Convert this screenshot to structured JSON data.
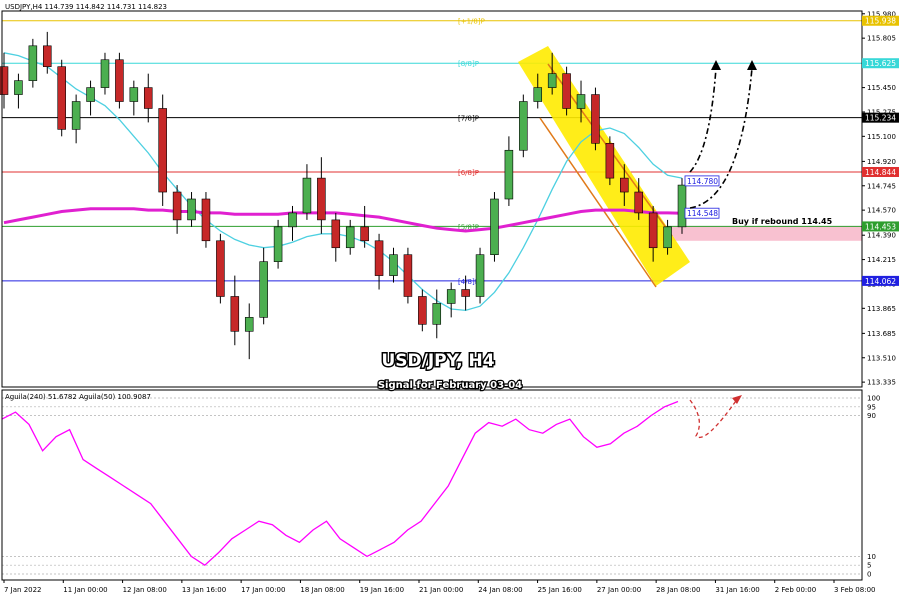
{
  "header": {
    "symbol_line": "USDJPY,H4  114.739 114.842 114.731 114.823",
    "indicator_line": "Aguila(240) 51.6782  Aguila(50) 100.9087"
  },
  "title": {
    "main": "USD/JPY, H4",
    "subtitle": "Signal for February 03-04"
  },
  "annotation": {
    "text": "Buy if rebound 114.45"
  },
  "colors": {
    "bull": "#4caf50",
    "bear": "#c62828",
    "sma_fast": "#4dd0e1",
    "sma_slow": "#e020d0",
    "channel_fill": "#ffeb00",
    "channel_border": "#e07a1a",
    "buy_zone": "#f7b6c8",
    "oscillator": "#ff00ff"
  },
  "chart_data": [
    {
      "type": "candlestick",
      "title": "USDJPY,H4",
      "ylim": [
        113.3,
        116.0
      ],
      "price_ticks": [
        "115.980",
        "115.805",
        "115.450",
        "115.275",
        "115.100",
        "114.920",
        "114.745",
        "114.570",
        "114.390",
        "114.215",
        "114.040",
        "113.865",
        "113.685",
        "113.510",
        "113.335"
      ],
      "date_ticks": [
        "7 Jan 2022",
        "11 Jan 00:00",
        "12 Jan 08:00",
        "13 Jan 16:00",
        "17 Jan 00:00",
        "18 Jan 08:00",
        "19 Jan 16:00",
        "21 Jan 00:00",
        "24 Jan 08:00",
        "25 Jan 16:00",
        "27 Jan 00:00",
        "28 Jan 08:00",
        "31 Jan 16:00",
        "2 Feb 00:00",
        "3 Feb 08:00"
      ],
      "murrey_levels": [
        {
          "label": "[+1/8]P",
          "price": 115.93,
          "color": "#e8c200",
          "value_label": "115.938"
        },
        {
          "label": "[8/8]P",
          "price": 115.625,
          "color": "#38d8d8",
          "value_label": "115.625"
        },
        {
          "label": "[7/8]P",
          "price": 115.234,
          "color": "#000000",
          "value_label": "115.234"
        },
        {
          "label": "[6/8]P",
          "price": 114.844,
          "color": "#e03030",
          "value_label": "114.844"
        },
        {
          "label": "[5/8]P",
          "price": 114.453,
          "color": "#2e9e2e",
          "value_label": "114.453"
        },
        {
          "label": "[4/8]P",
          "price": 114.062,
          "color": "#2020e0",
          "value_label": "114.062"
        }
      ],
      "marker_labels": [
        {
          "text": "114.780",
          "price": 114.78,
          "color": "#2020e0"
        },
        {
          "text": "114.548",
          "price": 114.548,
          "color": "#2020e0"
        }
      ],
      "candles": [
        [
          115.6,
          115.7,
          115.3,
          115.4
        ],
        [
          115.4,
          115.55,
          115.3,
          115.5
        ],
        [
          115.5,
          115.8,
          115.45,
          115.75
        ],
        [
          115.75,
          115.85,
          115.55,
          115.6
        ],
        [
          115.6,
          115.65,
          115.1,
          115.15
        ],
        [
          115.15,
          115.4,
          115.05,
          115.35
        ],
        [
          115.35,
          115.5,
          115.25,
          115.45
        ],
        [
          115.45,
          115.7,
          115.4,
          115.65
        ],
        [
          115.65,
          115.7,
          115.3,
          115.35
        ],
        [
          115.35,
          115.5,
          115.25,
          115.45
        ],
        [
          115.45,
          115.55,
          115.2,
          115.3
        ],
        [
          115.3,
          115.4,
          114.6,
          114.7
        ],
        [
          114.7,
          114.75,
          114.4,
          114.5
        ],
        [
          114.5,
          114.7,
          114.45,
          114.65
        ],
        [
          114.65,
          114.7,
          114.3,
          114.35
        ],
        [
          114.35,
          114.4,
          113.9,
          113.95
        ],
        [
          113.95,
          114.1,
          113.6,
          113.7
        ],
        [
          113.7,
          113.9,
          113.5,
          113.8
        ],
        [
          113.8,
          114.3,
          113.75,
          114.2
        ],
        [
          114.2,
          114.5,
          114.15,
          114.45
        ],
        [
          114.45,
          114.6,
          114.35,
          114.55
        ],
        [
          114.55,
          114.9,
          114.5,
          114.8
        ],
        [
          114.8,
          114.95,
          114.4,
          114.5
        ],
        [
          114.5,
          114.55,
          114.2,
          114.3
        ],
        [
          114.3,
          114.5,
          114.25,
          114.45
        ],
        [
          114.45,
          114.6,
          114.3,
          114.35
        ],
        [
          114.35,
          114.4,
          114.0,
          114.1
        ],
        [
          114.1,
          114.3,
          114.05,
          114.25
        ],
        [
          114.25,
          114.3,
          113.9,
          113.95
        ],
        [
          113.95,
          114.0,
          113.7,
          113.75
        ],
        [
          113.75,
          114.0,
          113.65,
          113.9
        ],
        [
          113.9,
          114.05,
          113.8,
          114.0
        ],
        [
          114.0,
          114.1,
          113.85,
          113.95
        ],
        [
          113.95,
          114.3,
          113.9,
          114.25
        ],
        [
          114.25,
          114.7,
          114.2,
          114.65
        ],
        [
          114.65,
          115.1,
          114.6,
          115.0
        ],
        [
          115.0,
          115.4,
          114.95,
          115.35
        ],
        [
          115.35,
          115.55,
          115.3,
          115.45
        ],
        [
          115.45,
          115.7,
          115.4,
          115.55
        ],
        [
          115.55,
          115.6,
          115.25,
          115.3
        ],
        [
          115.3,
          115.5,
          115.2,
          115.4
        ],
        [
          115.4,
          115.45,
          115.0,
          115.05
        ],
        [
          115.05,
          115.1,
          114.75,
          114.8
        ],
        [
          114.8,
          114.9,
          114.6,
          114.7
        ],
        [
          114.7,
          114.8,
          114.5,
          114.55
        ],
        [
          114.55,
          114.6,
          114.2,
          114.3
        ],
        [
          114.3,
          114.5,
          114.25,
          114.45
        ],
        [
          114.45,
          114.8,
          114.4,
          114.75
        ]
      ],
      "series": [
        {
          "name": "fast MA",
          "values": [
            115.7,
            115.68,
            115.64,
            115.6,
            115.52,
            115.44,
            115.38,
            115.32,
            115.22,
            115.1,
            114.98,
            114.84,
            114.72,
            114.6,
            114.5,
            114.42,
            114.36,
            114.32,
            114.3,
            114.31,
            114.34,
            114.38,
            114.4,
            114.4,
            114.38,
            114.34,
            114.28,
            114.2,
            114.1,
            114.0,
            113.92,
            113.86,
            113.85,
            113.88,
            113.98,
            114.12,
            114.3,
            114.5,
            114.72,
            114.92,
            115.06,
            115.14,
            115.16,
            115.12,
            115.02,
            114.9,
            114.82,
            114.8
          ]
        },
        {
          "name": "slow MA",
          "values": [
            114.48,
            114.5,
            114.52,
            114.54,
            114.56,
            114.57,
            114.58,
            114.58,
            114.58,
            114.58,
            114.57,
            114.57,
            114.56,
            114.56,
            114.55,
            114.55,
            114.54,
            114.54,
            114.54,
            114.54,
            114.55,
            114.55,
            114.55,
            114.55,
            114.54,
            114.53,
            114.52,
            114.5,
            114.48,
            114.46,
            114.44,
            114.43,
            114.42,
            114.43,
            114.44,
            114.46,
            114.48,
            114.5,
            114.52,
            114.54,
            114.56,
            114.57,
            114.57,
            114.57,
            114.56,
            114.55,
            114.55,
            114.548
          ]
        }
      ]
    },
    {
      "type": "line",
      "title": "Aguila",
      "ylim": [
        0,
        100
      ],
      "y_ticks": [
        "100",
        "95",
        "90",
        "10",
        "5",
        "0"
      ],
      "series": [
        {
          "name": "Aguila",
          "values": [
            88,
            92,
            85,
            70,
            78,
            82,
            65,
            60,
            55,
            50,
            45,
            40,
            30,
            20,
            10,
            5,
            12,
            20,
            25,
            30,
            28,
            22,
            18,
            25,
            30,
            20,
            15,
            10,
            14,
            18,
            25,
            30,
            40,
            50,
            65,
            80,
            86,
            84,
            88,
            82,
            80,
            85,
            88,
            78,
            72,
            74,
            80,
            84,
            90,
            95,
            98
          ]
        }
      ]
    }
  ]
}
